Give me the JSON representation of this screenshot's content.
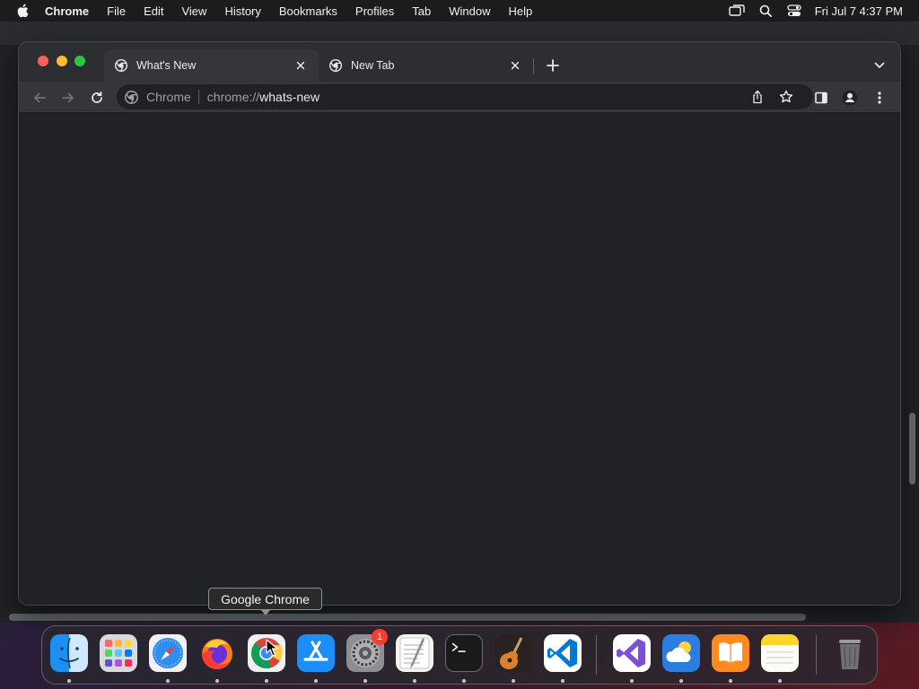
{
  "menubar": {
    "apple_icon": "apple-logo-icon",
    "items": [
      {
        "label": "Chrome"
      },
      {
        "label": "File"
      },
      {
        "label": "Edit"
      },
      {
        "label": "View"
      },
      {
        "label": "History"
      },
      {
        "label": "Bookmarks"
      },
      {
        "label": "Profiles"
      },
      {
        "label": "Tab"
      },
      {
        "label": "Window"
      },
      {
        "label": "Help"
      }
    ],
    "status_icons": [
      "screen-mirroring-icon",
      "spotlight-search-icon",
      "control-center-icon"
    ],
    "clock": "Fri Jul 7  4:37 PM"
  },
  "browser": {
    "tabs": [
      {
        "title": "What's New",
        "active": true,
        "favicon": "chrome-favicon-icon"
      },
      {
        "title": "New Tab",
        "active": false,
        "favicon": "chrome-favicon-icon"
      }
    ],
    "omnibox": {
      "chip": "Chrome",
      "url_scheme": "chrome://",
      "url_host": "whats-new"
    },
    "colors": {
      "frame": "#2d2e31",
      "toolbar": "#35363a",
      "content": "#202124",
      "text": "#e8eaed",
      "muted": "#9aa0a6"
    }
  },
  "tooltip": {
    "text": "Google Chrome"
  },
  "dock": {
    "apps": [
      {
        "name": "Finder",
        "icon": "finder-icon",
        "running": true
      },
      {
        "name": "Launchpad",
        "icon": "launchpad-icon",
        "running": false
      },
      {
        "name": "Safari",
        "icon": "safari-icon",
        "running": true
      },
      {
        "name": "Firefox",
        "icon": "firefox-icon",
        "running": true
      },
      {
        "name": "Google Chrome",
        "icon": "chrome-icon",
        "running": true
      },
      {
        "name": "App Store",
        "icon": "app-store-icon",
        "running": true
      },
      {
        "name": "System Settings",
        "icon": "system-settings-icon",
        "running": true,
        "badge": "1"
      },
      {
        "name": "TextEdit",
        "icon": "textedit-icon",
        "running": true
      },
      {
        "name": "Terminal",
        "icon": "terminal-icon",
        "running": true
      },
      {
        "name": "GarageBand",
        "icon": "garageband-icon",
        "running": true
      },
      {
        "name": "Visual Studio Code",
        "icon": "vscode-icon",
        "running": true
      },
      {
        "name": "Visual Studio",
        "icon": "visual-studio-icon",
        "running": true
      },
      {
        "name": "Weather",
        "icon": "weather-icon",
        "running": true
      },
      {
        "name": "Books",
        "icon": "books-icon",
        "running": true
      },
      {
        "name": "Notes",
        "icon": "notes-icon",
        "running": true
      },
      {
        "name": "Trash",
        "icon": "trash-icon",
        "running": false
      }
    ]
  }
}
